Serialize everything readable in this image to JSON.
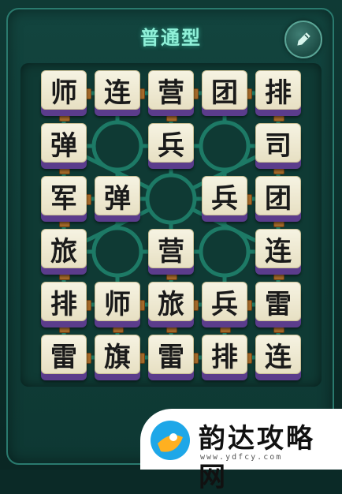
{
  "header": {
    "title": "普通型",
    "edit_icon": "pencil-icon"
  },
  "board": {
    "rows": [
      [
        "师",
        "连",
        "营",
        "团",
        "排"
      ],
      [
        "弹",
        "",
        "兵",
        "",
        "司"
      ],
      [
        "军",
        "弹",
        "",
        "兵",
        "团"
      ],
      [
        "旅",
        "",
        "营",
        "",
        "连"
      ],
      [
        "排",
        "师",
        "旅",
        "兵",
        "雷"
      ],
      [
        "雷",
        "旗",
        "雷",
        "排",
        "连"
      ]
    ],
    "camps": [
      [
        1,
        1
      ],
      [
        1,
        3
      ],
      [
        2,
        2
      ],
      [
        3,
        1
      ],
      [
        3,
        3
      ]
    ]
  },
  "watermark": {
    "name": "韵达攻略网",
    "url": "www.ydfcy.com"
  },
  "colors": {
    "background": "#0b2a27",
    "accent": "#8ff0d8",
    "tile_face": "#f6f3e2",
    "tile_base": "#5b3c8c",
    "railway": "#1d7a66"
  }
}
